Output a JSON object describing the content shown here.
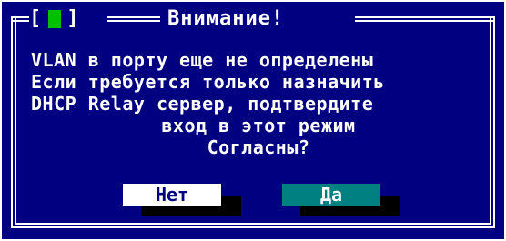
{
  "dialog": {
    "title": "Внимание!",
    "close_left": "[",
    "close_right": "]",
    "message_lines": [
      "VLAN в порту еще не определены",
      "Если требуется только назначить",
      "DHCP Relay сервер, подтвердите",
      "вход в этот режим",
      "Согласны?"
    ],
    "buttons": {
      "no_label": "Нет",
      "yes_label": "Да"
    },
    "colors": {
      "background": "#000080",
      "text": "#ffffff",
      "no_button": "#ffffff",
      "yes_button": "#008080",
      "close_indicator": "#00c000"
    }
  }
}
